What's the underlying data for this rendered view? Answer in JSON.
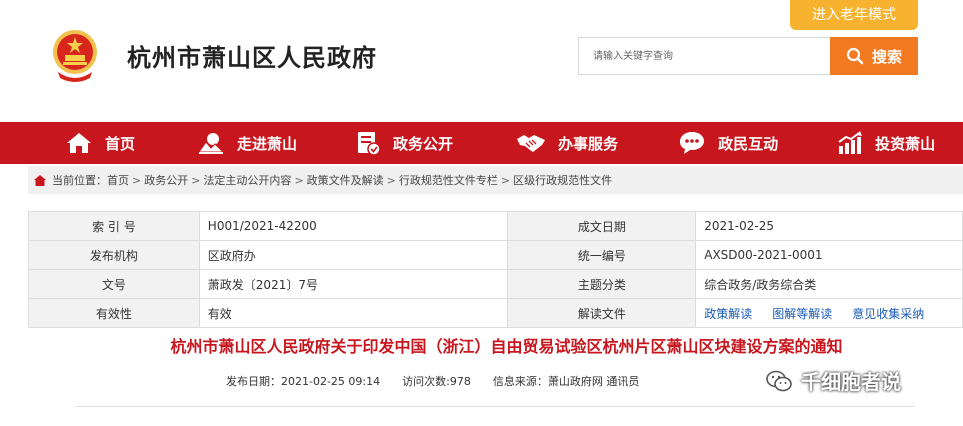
{
  "header": {
    "site_title": "杭州市萧山区人民政府",
    "elder_mode_label": "进入老年模式",
    "search_placeholder": "请输入关键字查询",
    "search_button_label": "搜索",
    "colors": {
      "red": "#c8161e",
      "orange": "#f47a21",
      "gold": "#f7b32f"
    }
  },
  "nav": {
    "items": [
      {
        "label": "首页",
        "icon": "home-icon"
      },
      {
        "label": "走进萧山",
        "icon": "landscape-icon"
      },
      {
        "label": "政务公开",
        "icon": "document-icon"
      },
      {
        "label": "办事服务",
        "icon": "handshake-icon"
      },
      {
        "label": "政民互动",
        "icon": "chat-icon"
      },
      {
        "label": "投资萧山",
        "icon": "growth-chart-icon"
      }
    ]
  },
  "breadcrumb": {
    "prefix": "当前位置：",
    "items": [
      "首页",
      "政务公开",
      "法定主动公开内容",
      "政策文件及解读",
      "行政规范性文件专栏",
      "区级行政规范性文件"
    ],
    "separator": ">"
  },
  "info": {
    "rows": [
      {
        "label1": "索 引 号",
        "value1": "H001/2021-42200",
        "label2": "成文日期",
        "value2": "2021-02-25"
      },
      {
        "label1": "发布机构",
        "value1": "区政府办",
        "label2": "统一编号",
        "value2": "AXSD00-2021-0001"
      },
      {
        "label1": "文号",
        "value1": "萧政发〔2021〕7号",
        "label2": "主题分类",
        "value2": "综合政务/政务综合类"
      },
      {
        "label1": "有效性",
        "value1": "有效",
        "label2": "解读文件",
        "value2": ""
      }
    ],
    "links": [
      "政策解读",
      "图解等解读",
      "意见收集采纳"
    ]
  },
  "document": {
    "title": "杭州市萧山区人民政府关于印发中国（浙江）自由贸易试验区杭州片区萧山区块建设方案的通知",
    "publish_date": "发布日期：2021-02-25 09:14",
    "views": "访问次数:978",
    "source": "信息来源：萧山政府网 通讯员"
  },
  "watermark": {
    "text": "千细胞者说",
    "icon": "wechat-icon"
  }
}
